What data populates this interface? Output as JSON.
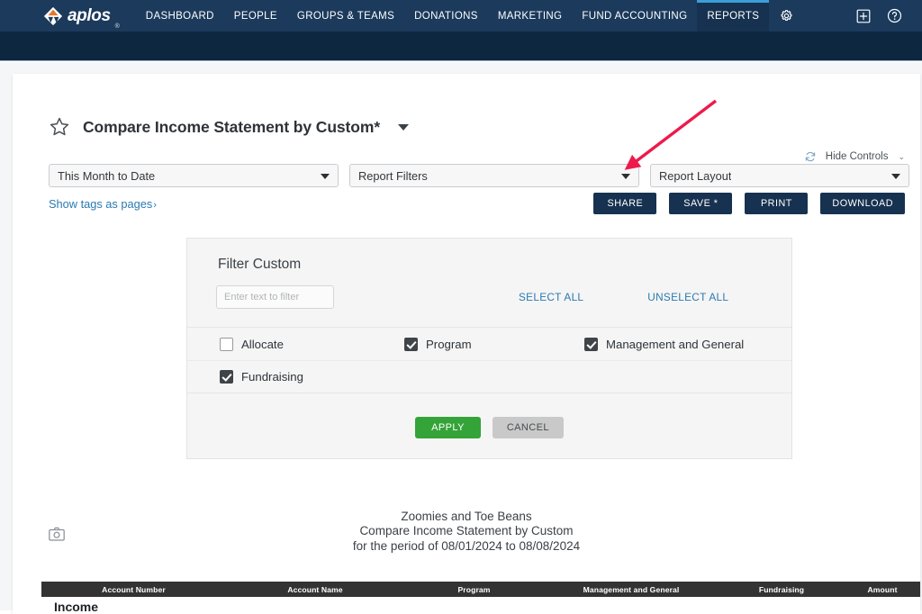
{
  "nav": {
    "brand": "aplos",
    "brand_reg": "®",
    "items": [
      {
        "label": "DASHBOARD",
        "active": false
      },
      {
        "label": "PEOPLE",
        "active": false
      },
      {
        "label": "GROUPS & TEAMS",
        "active": false
      },
      {
        "label": "DONATIONS",
        "active": false
      },
      {
        "label": "MARKETING",
        "active": false
      },
      {
        "label": "FUND ACCOUNTING",
        "active": false
      },
      {
        "label": "REPORTS",
        "active": true
      }
    ],
    "settings_icon": "gear-icon",
    "right_icons": [
      "add-square-icon",
      "help-circle-icon"
    ]
  },
  "report": {
    "title": "Compare Income Statement by Custom*",
    "favorite_icon": "star-outline-icon",
    "hide_controls_label": "Hide Controls",
    "hide_controls_caret": "⌄",
    "refresh_icon": "refresh-icon"
  },
  "selectors": {
    "date_range": "This Month to Date",
    "report_filters": "Report Filters",
    "report_layout": "Report Layout"
  },
  "links": {
    "show_tags_as_pages": "Show tags as pages",
    "show_tags_chevron": "›"
  },
  "actions": {
    "share": "SHARE",
    "save": "SAVE *",
    "print": "PRINT",
    "download": "DOWNLOAD"
  },
  "filter_panel": {
    "title": "Filter Custom",
    "search_placeholder": "Enter text to filter",
    "search_value": "",
    "select_all": "SELECT ALL",
    "unselect_all": "UNSELECT ALL",
    "options": [
      {
        "label": "Allocate",
        "checked": false
      },
      {
        "label": "Program",
        "checked": true
      },
      {
        "label": "Management and General",
        "checked": true
      },
      {
        "label": "Fundraising",
        "checked": true
      }
    ],
    "apply": "APPLY",
    "cancel": "CANCEL"
  },
  "report_body": {
    "camera_icon": "camera-icon",
    "organization": "Zoomies and Toe Beans",
    "report_name": "Compare Income Statement by Custom",
    "period": "for the period of 08/01/2024 to 08/08/2024",
    "columns": [
      "Account Number",
      "Account Name",
      "Program",
      "Management and General",
      "Fundraising",
      "Amount"
    ],
    "section_label": "Income"
  },
  "annotation": {
    "type": "arrow",
    "color": "#ed1b4b",
    "points_to": "report-filters-dropdown-caret"
  },
  "colors": {
    "nav_bg": "#1b3a5c",
    "subnav_bg": "#0d2740",
    "accent_tab": "#3a9fd8",
    "button_dark": "#173250",
    "button_apply": "#34a338",
    "button_cancel": "#c9c9c9",
    "link_blue": "#2a7ab0",
    "table_header": "#333333",
    "page_bg": "#f4f6f8"
  }
}
